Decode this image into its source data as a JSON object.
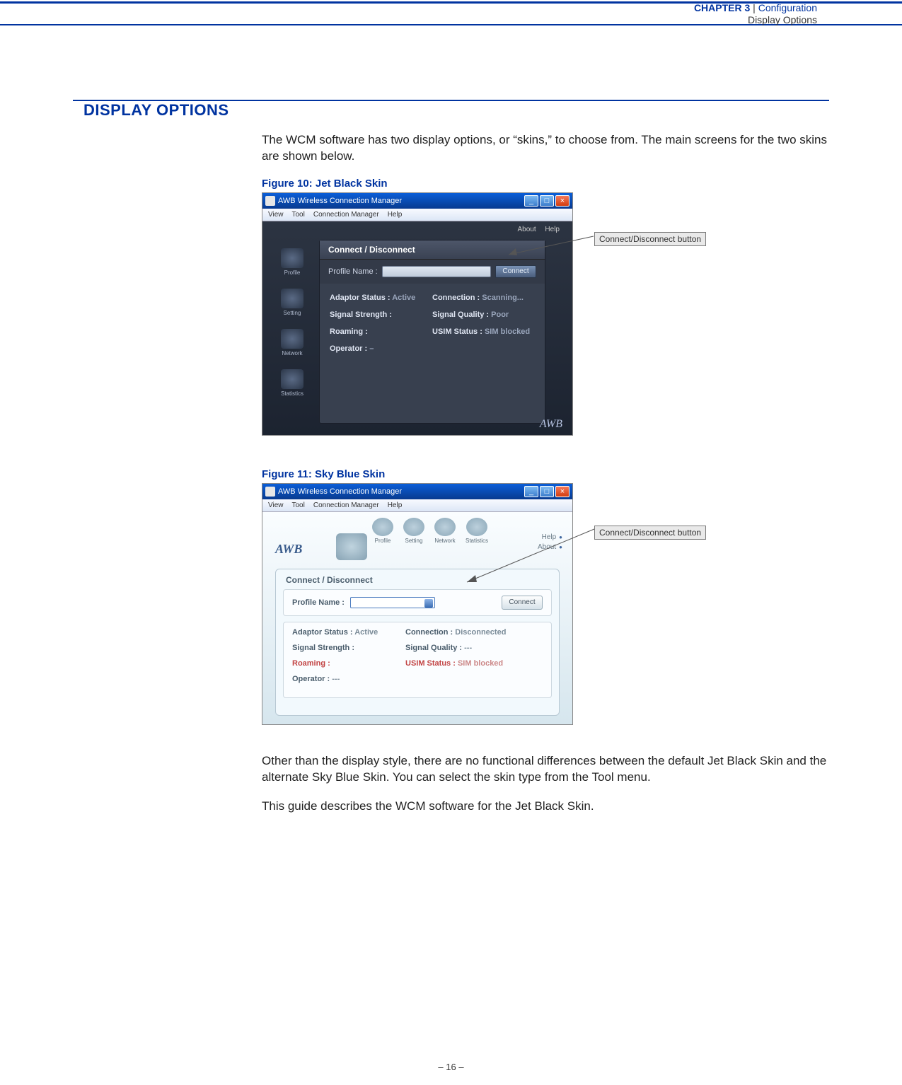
{
  "header": {
    "chapter": "CHAPTER 3",
    "sep": "  |  ",
    "title": "Configuration",
    "subtitle": "Display Options"
  },
  "section_title": "DISPLAY OPTIONS",
  "intro": "The WCM software has two display options, or “skins,” to choose from. The main screens for the two skins are shown below.",
  "fig1_caption": "Figure 10:  Jet Black Skin",
  "fig2_caption": "Figure 11:  Sky Blue Skin",
  "app_title": "AWB Wireless Connection Manager",
  "menubar": {
    "view": "View",
    "tool": "Tool",
    "cm": "Connection Manager",
    "help": "Help"
  },
  "toplinks": {
    "about": "About",
    "help": "Help"
  },
  "panel": {
    "header": "Connect / Disconnect",
    "profile_label": "Profile Name :",
    "connect_btn": "Connect"
  },
  "sidebar": {
    "profile": "Profile",
    "setting": "Setting",
    "network": "Network",
    "statistics": "Statistics"
  },
  "stats1": {
    "adaptor_k": "Adaptor Status :",
    "adaptor_v": "Active",
    "conn_k": "Connection :",
    "conn_v": "Scanning...",
    "sig_k": "Signal Strength :",
    "qual_k": "Signal Quality :",
    "qual_v": "Poor",
    "roam_k": "Roaming :",
    "usim_k": "USIM Status :",
    "usim_v": "SIM blocked",
    "op_k": "Operator :",
    "op_v": "–"
  },
  "logo": "AWB",
  "stats2": {
    "adaptor_k": "Adaptor Status :",
    "adaptor_v": "Active",
    "conn_k": "Connection :",
    "conn_v": "Disconnected",
    "sig_k": "Signal Strength :",
    "qual_k": "Signal Quality :",
    "qual_v": "---",
    "roam_k": "Roaming :",
    "usim_k": "USIM Status :",
    "usim_v": "SIM blocked",
    "op_k": "Operator :",
    "op_v": "---"
  },
  "callout_label": "Connect/Disconnect button",
  "body2": "Other than the display style, there are no functional differences between the default Jet Black Skin and the alternate Sky Blue Skin. You can select the skin type from the Tool menu.",
  "body3": "This guide describes the WCM software for the Jet Black Skin.",
  "page_num": "–  16  –"
}
